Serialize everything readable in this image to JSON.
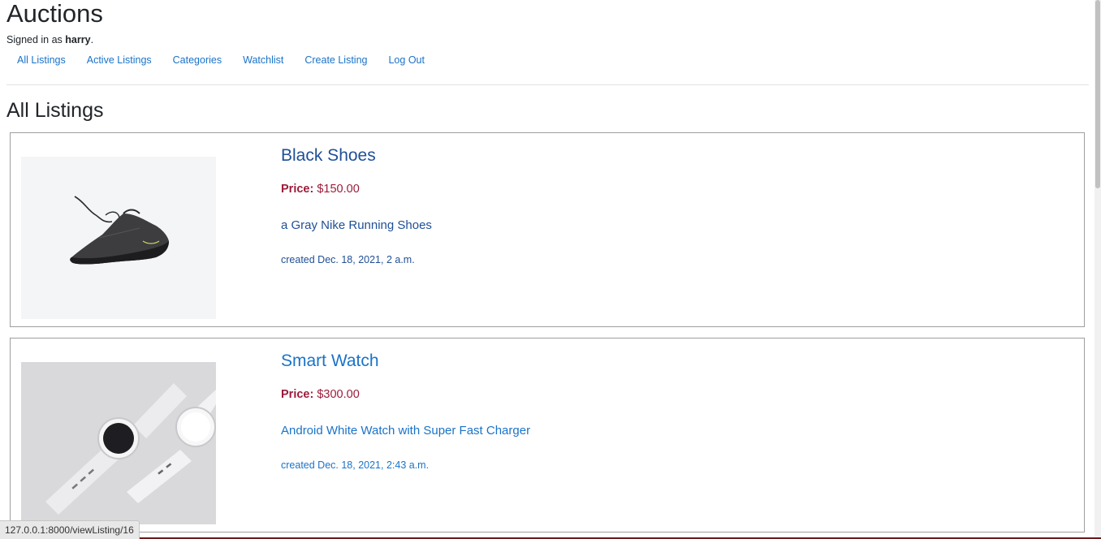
{
  "site": {
    "title": "Auctions",
    "signed_in_prefix": "Signed in as ",
    "username": "harry",
    "signed_in_suffix": "."
  },
  "nav": {
    "items": [
      {
        "label": "All Listings"
      },
      {
        "label": "Active Listings"
      },
      {
        "label": "Categories"
      },
      {
        "label": "Watchlist"
      },
      {
        "label": "Create Listing"
      },
      {
        "label": "Log Out"
      }
    ]
  },
  "main": {
    "heading": "All Listings",
    "listings": [
      {
        "title": "Black Shoes",
        "price_label": "Price:",
        "price": "$150.00",
        "description": "a Gray Nike Running Shoes",
        "created": "created Dec. 18, 2021, 2 a.m.",
        "image": "black-running-shoe"
      },
      {
        "title": "Smart Watch",
        "price_label": "Price:",
        "price": "$300.00",
        "description": "Android White Watch with Super Fast Charger",
        "created": "created Dec. 18, 2021, 2:43 a.m.",
        "image": "white-smart-watches"
      }
    ]
  },
  "status_bar": {
    "url": "127.0.0.1:8000/viewListing/16"
  },
  "colors": {
    "link": "#1a73c8",
    "visited_link": "#1f4f96",
    "price": "#9c1c3a"
  }
}
